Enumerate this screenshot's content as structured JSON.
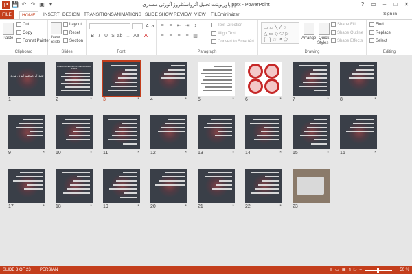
{
  "window": {
    "title": "پاورپوینت تحلیل آترواسکلروز آئورتی مصدری.pptx - PowerPoint",
    "app_icon": "P",
    "controls": [
      "?",
      "▭",
      "–",
      "□",
      "✕"
    ]
  },
  "qat": {
    "save": "💾",
    "undo": "↶",
    "redo": "↷",
    "start": "▣",
    "more": "▾"
  },
  "tabs": {
    "file": "FILE",
    "home": "HOME",
    "insert": "INSERT",
    "design": "DESIGN",
    "transitions": "TRANSITIONS",
    "animations": "ANIMATIONS",
    "slideshow": "SLIDE SHOW",
    "review": "REVIEW",
    "view": "VIEW",
    "fileminimizer": "FILEminimizer"
  },
  "signin": "Sign in",
  "ribbon": {
    "clipboard": {
      "paste": "Paste",
      "cut": "Cut",
      "copy": "Copy",
      "format_painter": "Format Painter",
      "label": "Clipboard"
    },
    "slides": {
      "new_slide": "New",
      "new_slide2": "Slide",
      "layout": "Layout",
      "reset": "Reset",
      "section": "Section",
      "label": "Slides"
    },
    "font": {
      "label": "Font"
    },
    "paragraph": {
      "text_direction": "Text Direction",
      "align_text": "Align Text",
      "convert_smartart": "Convert to SmartArt",
      "label": "Paragraph"
    },
    "drawing": {
      "arrange": "Arrange",
      "quick_styles": "Quick",
      "quick_styles2": "Styles",
      "shape_fill": "Shape Fill",
      "shape_outline": "Shape Outline",
      "shape_effects": "Shape Effects",
      "label": "Drawing"
    },
    "editing": {
      "find": "Find",
      "replace": "Replace",
      "select": "Select",
      "label": "Editing"
    }
  },
  "slides": [
    {
      "n": "1",
      "star": ""
    },
    {
      "n": "2",
      "star": "*"
    },
    {
      "n": "3",
      "star": "*"
    },
    {
      "n": "4",
      "star": "*"
    },
    {
      "n": "5",
      "star": "*"
    },
    {
      "n": "6",
      "star": "*"
    },
    {
      "n": "7",
      "star": "*"
    },
    {
      "n": "8",
      "star": "*"
    },
    {
      "n": "9",
      "star": "*"
    },
    {
      "n": "10",
      "star": "*"
    },
    {
      "n": "11",
      "star": "*"
    },
    {
      "n": "12",
      "star": "*"
    },
    {
      "n": "13",
      "star": "*"
    },
    {
      "n": "14",
      "star": "*"
    },
    {
      "n": "15",
      "star": "*"
    },
    {
      "n": "16",
      "star": "*"
    },
    {
      "n": "17",
      "star": "*"
    },
    {
      "n": "18",
      "star": "*"
    },
    {
      "n": "19",
      "star": "*"
    },
    {
      "n": "20",
      "star": "*"
    },
    {
      "n": "21",
      "star": "*"
    },
    {
      "n": "22",
      "star": "*"
    },
    {
      "n": "23",
      "star": ""
    }
  ],
  "selected_slide": "3",
  "slide1_title": "تحلیل آترواسکلروز آئورتی صدری",
  "slide2_title": "ATHEROSCLEROSIS OF THE THORACIC AORTA",
  "statusbar": {
    "slide": "SLIDE 3 OF 23",
    "language": "PERSIAN",
    "zoom": "50 %",
    "zoom_minus": "–",
    "zoom_plus": "+"
  }
}
